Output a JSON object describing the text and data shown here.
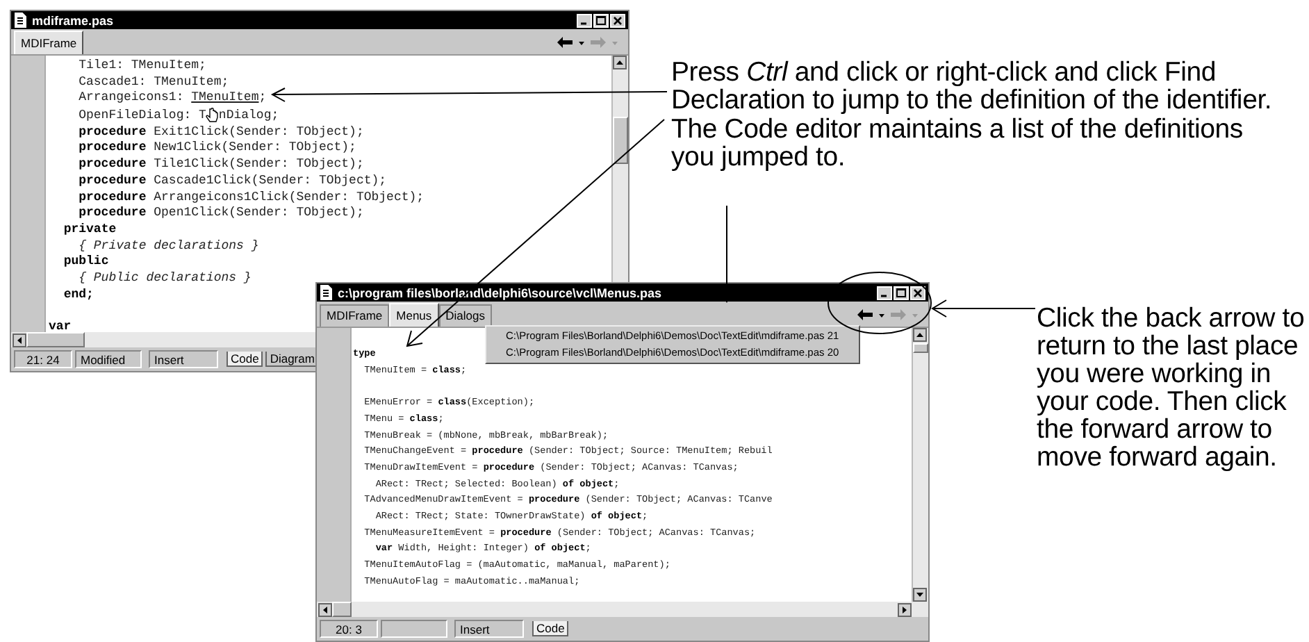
{
  "windows": [
    {
      "title": "mdiframe.pas",
      "tabs": [
        {
          "label": "MDIFrame",
          "selected": true
        }
      ],
      "nav": {
        "back_enabled": true,
        "forward_enabled": false
      },
      "lines": [
        "    Tile1: TMenuItem;",
        "    Cascade1: TMenuItem;",
        {
          "parts": [
            {
              "kind": "code",
              "text": "    Arrangeicons1: "
            },
            {
              "kind": "link",
              "text": "TMenuItem"
            },
            {
              "kind": "code",
              "text": ";"
            }
          ]
        },
        {
          "parts": [
            {
              "kind": "code",
              "text": "    OpenFileDialog: T"
            },
            {
              "kind": "cursor"
            },
            {
              "kind": "code",
              "text": "nDialog;"
            }
          ]
        },
        "    **procedure** Exit1Click(Sender: TObject);",
        "    **procedure** New1Click(Sender: TObject);",
        "    **procedure** Tile1Click(Sender: TObject);",
        "    **procedure** Cascade1Click(Sender: TObject);",
        "    **procedure** Arrangeicons1Click(Sender: TObject);",
        "    **procedure** Open1Click(Sender: TObject);",
        "  **private**",
        "    *{ Private declarations }*",
        "  **public**",
        "    *{ Public declarations }*",
        "  **end;**",
        "\n**var**"
      ],
      "status": {
        "position": "21: 24",
        "modified": "Modified",
        "mode": "Insert"
      },
      "view_tabs": [
        {
          "label": "Code",
          "selected": true
        },
        {
          "label": "Diagram",
          "selected": false
        }
      ]
    },
    {
      "title": "c:\\program files\\borland\\delphi6\\source\\vcl\\Menus.pas",
      "tabs": [
        {
          "label": "MDIFrame",
          "selected": false
        },
        {
          "label": "Menus",
          "selected": true
        },
        {
          "label": "Dialogs",
          "selected": false
        }
      ],
      "nav": {
        "back_enabled": true,
        "forward_enabled": false
      },
      "history": [
        "C:\\Program Files\\Borland\\Delphi6\\Demos\\Doc\\TextEdit\\mdiframe.pas 21",
        "C:\\Program Files\\Borland\\Delphi6\\Demos\\Doc\\TextEdit\\mdiframe.pas 20"
      ],
      "lines": [
        "**type**",
        "  TMenuItem = **class**;",
        "\n  EMenuError = **class**(Exception);",
        "  TMenu = **class**;",
        "  TMenuBreak = (mbNone, mbBreak, mbBarBreak);",
        "  TMenuChangeEvent = **procedure** (Sender: TObject; Source: TMenuItem; Rebuil",
        "  TMenuDrawItemEvent = **procedure** (Sender: TObject; ACanvas: TCanvas;",
        "    ARect: TRect; Selected: Boolean) **of object**;",
        "  TAdvancedMenuDrawItemEvent = **procedure** (Sender: TObject; ACanvas: TCanve",
        "    ARect: TRect; State: TOwnerDrawState) **of object**;",
        "  TMenuMeasureItemEvent = **procedure** (Sender: TObject; ACanvas: TCanvas;",
        "    **var** Width, Height: Integer) **of object**;",
        "  TMenuItemAutoFlag = (maAutomatic, maManual, maParent);",
        "  TMenuAutoFlag = maAutomatic..maManual;"
      ],
      "status": {
        "position": "20: 3",
        "mode": "Insert"
      },
      "view_tabs": [
        {
          "label": "Code",
          "selected": true
        }
      ]
    }
  ],
  "callouts": [
    {
      "text": "Press *Ctrl* and click or right-click and click Find Declaration to jump to the definition of the identifier."
    },
    {
      "text": "The Code editor maintains a list of the definitions you jumped to."
    },
    {
      "text": "Click the back arrow to return to the last place you were working in your code. Then click the forward arrow to move forward again."
    }
  ]
}
